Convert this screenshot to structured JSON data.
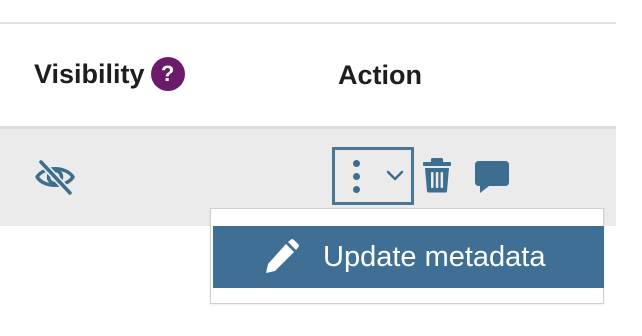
{
  "table": {
    "headers": {
      "visibility": "Visibility",
      "visibility_help": "?",
      "action": "Action"
    },
    "row": {
      "visibility_icon": "eye-slash-icon",
      "actions": {
        "menu_icon": "kebab-menu-icon",
        "delete_icon": "trash-icon",
        "comment_icon": "comment-icon"
      }
    }
  },
  "dropdown": {
    "items": [
      {
        "label": "Update metadata",
        "icon": "pencil-icon"
      }
    ]
  },
  "colors": {
    "help_badge": "#6a1b69",
    "accent": "#3f6f94",
    "row_bg": "#ebebeb"
  }
}
